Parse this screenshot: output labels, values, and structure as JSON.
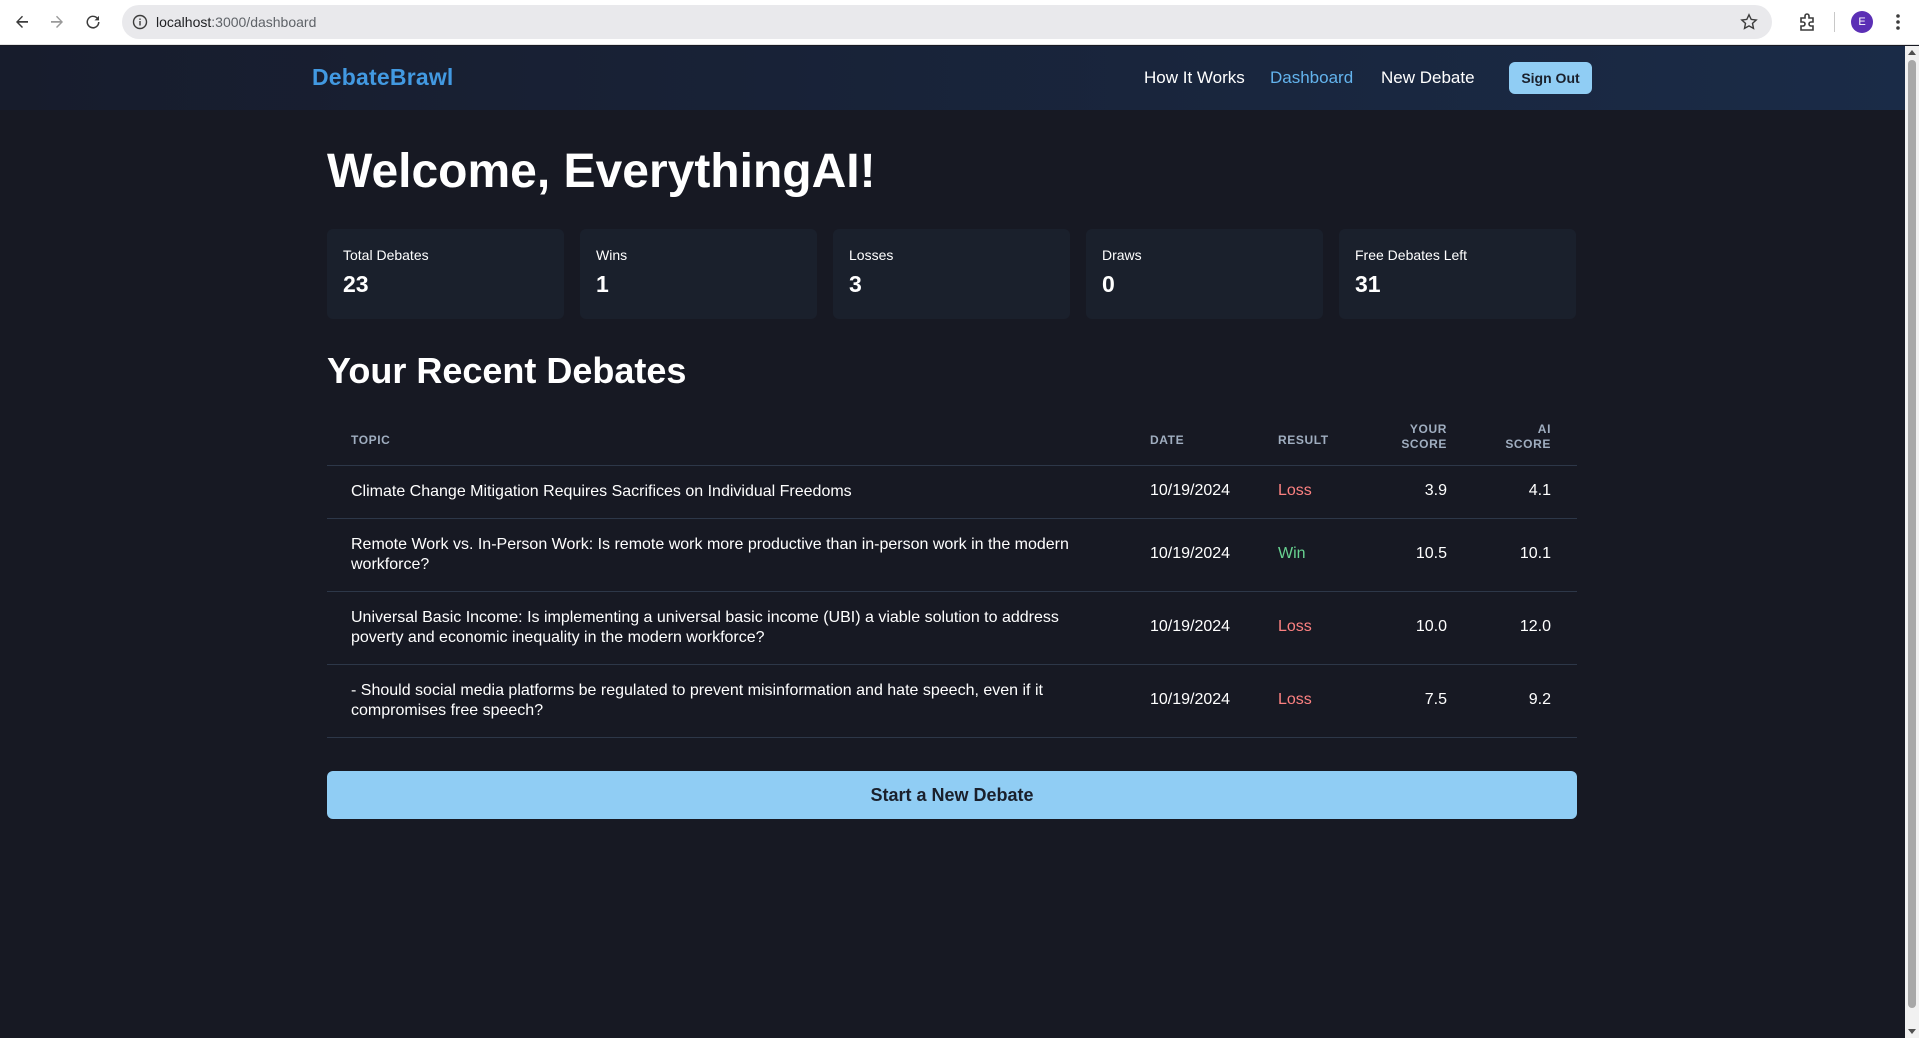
{
  "browser": {
    "url_host": "localhost",
    "url_path": ":3000/dashboard",
    "profile_initial": "E"
  },
  "header": {
    "brand": "DebateBrawl",
    "nav": [
      {
        "label": "How It Works",
        "active": false
      },
      {
        "label": "Dashboard",
        "active": true
      },
      {
        "label": "New Debate",
        "active": false
      }
    ],
    "sign_out": "Sign Out"
  },
  "main": {
    "welcome": "Welcome, EverythingAI!",
    "stats": [
      {
        "label": "Total Debates",
        "value": "23"
      },
      {
        "label": "Wins",
        "value": "1"
      },
      {
        "label": "Losses",
        "value": "3"
      },
      {
        "label": "Draws",
        "value": "0"
      },
      {
        "label": "Free Debates Left",
        "value": "31"
      }
    ],
    "recent_title": "Your Recent Debates",
    "table": {
      "headers": {
        "topic": "Topic",
        "date": "Date",
        "result": "Result",
        "your_score_1": "Your",
        "your_score_2": "Score",
        "ai_score_1": "AI",
        "ai_score_2": "Score"
      },
      "rows": [
        {
          "topic": "Climate Change Mitigation Requires Sacrifices on Individual Freedoms",
          "date": "10/19/2024",
          "result": "Loss",
          "your_score": "3.9",
          "ai_score": "4.1"
        },
        {
          "topic": "Remote Work vs. In-Person Work: Is remote work more productive than in-person work in the modern workforce?",
          "date": "10/19/2024",
          "result": "Win",
          "your_score": "10.5",
          "ai_score": "10.1"
        },
        {
          "topic": "Universal Basic Income: Is implementing a universal basic income (UBI) a viable solution to address poverty and economic inequality in the modern workforce?",
          "date": "10/19/2024",
          "result": "Loss",
          "your_score": "10.0",
          "ai_score": "12.0"
        },
        {
          "topic": "- Should social media platforms be regulated to prevent misinformation and hate speech, even if it compromises free speech?",
          "date": "10/19/2024",
          "result": "Loss",
          "your_score": "7.5",
          "ai_score": "9.2"
        }
      ]
    },
    "start_button": "Start a New Debate"
  },
  "colors": {
    "background": "#171923",
    "brand": "#4299e1",
    "accent_button": "#90cdf4",
    "win": "#68d391",
    "loss": "#fc8181"
  }
}
